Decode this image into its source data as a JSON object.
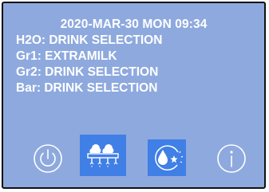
{
  "header": {
    "datetime": "2020-MAR-30 MON 09:34"
  },
  "status": [
    "H2O: DRINK SELECTION",
    "Gr1: EXTRAMILK",
    "Gr2: DRINK SELECTION",
    "Bar: DRINK SELECTION"
  ],
  "icons": {
    "power": "power-icon",
    "milk_nozzles": "milk-nozzles-icon",
    "cleaning": "cleaning-drop-sparkle-icon",
    "info": "info-icon"
  },
  "colors": {
    "screen_background": "#8ea9de",
    "text": "#ffffff",
    "icon_highlight": "#3f7fe6"
  }
}
